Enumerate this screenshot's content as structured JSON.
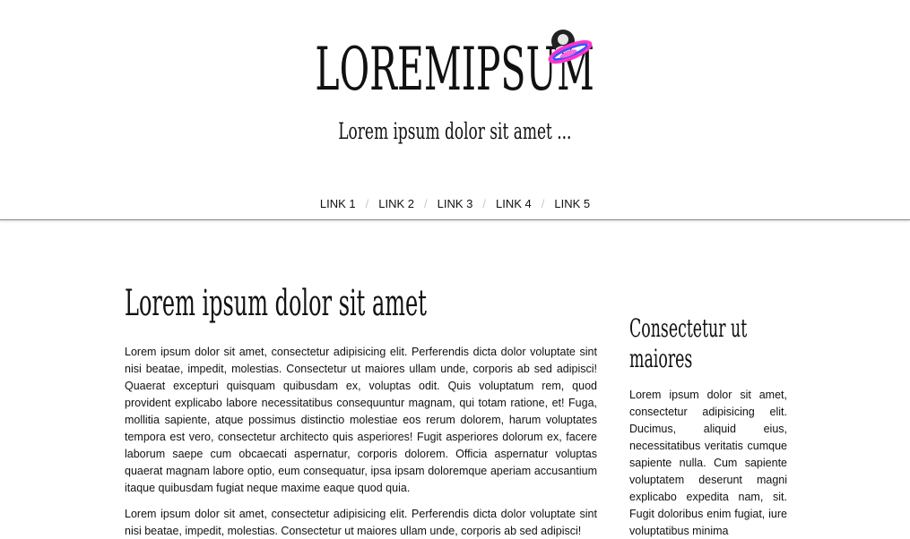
{
  "header": {
    "logo": "LOREMIPSUM",
    "tagline": "Lorem ipsum dolor sit amet ..."
  },
  "nav": {
    "links": [
      "LINK 1",
      "LINK 2",
      "LINK 3",
      "LINK 4",
      "LINK 5"
    ],
    "separator": "/"
  },
  "main": {
    "title": "Lorem ipsum dolor sit amet",
    "paragraphs": [
      "Lorem ipsum dolor sit amet, consectetur adipisicing elit. Perferendis dicta dolor voluptate sint nisi beatae, impedit, molestias. Consectetur ut maiores ullam unde, corporis ab sed adipisci! Quaerat excepturi quisquam quibusdam ex, voluptas odit. Quis voluptatum rem, quod provident explicabo labore necessitatibus consequuntur magnam, qui totam ratione, et! Fuga, mollitia sapiente, atque possimus distinctio molestiae eos rerum dolorem, harum voluptates tempora est vero, consectetur architecto quis asperiores! Fugit asperiores dolorum ex, facere laborum saepe cum obcaecati aspernatur, corporis dolorem. Officia aspernatur voluptas quaerat magnam labore optio, eum consequatur, ipsa ipsam doloremque aperiam accusantium itaque quibusdam fugiat neque maxime eaque quod quia.",
      "Lorem ipsum dolor sit amet, consectetur adipisicing elit. Perferendis dicta dolor voluptate sint nisi beatae, impedit, molestias. Consectetur ut maiores ullam unde, corporis ab sed adipisci!"
    ]
  },
  "sidebar": {
    "title": "Consectetur ut maiores",
    "text": "Lorem ipsum dolor sit amet, consectetur adipisicing elit. Ducimus, aliquid eius, necessitatibus veritatis cumque sapiente nulla. Cum sapiente voluptatem deserunt magni explicabo expedita nam, sit. Fugit doloribus enim fugiat, iure voluptatibus minima"
  }
}
